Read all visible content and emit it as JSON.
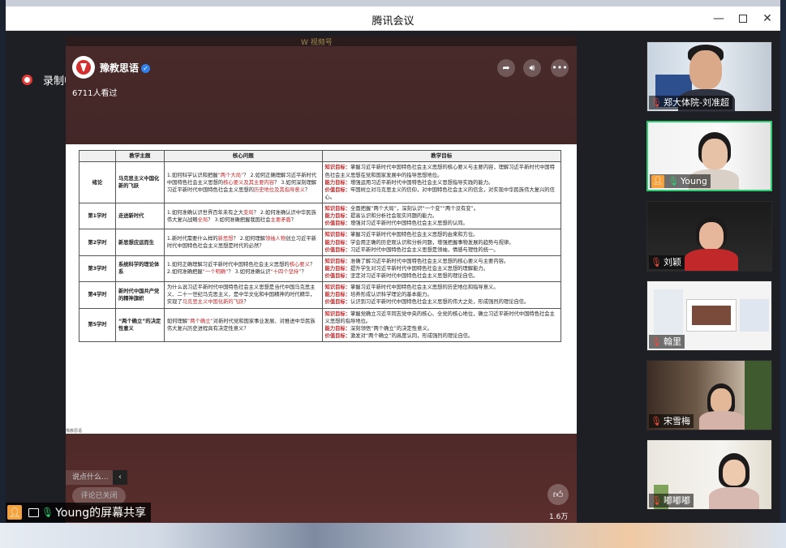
{
  "window": {
    "title": "腾讯会议"
  },
  "recording": {
    "label": "录制中"
  },
  "shared": {
    "top_logo": "W 视频号",
    "channel_name": "豫教思语",
    "viewed": "6711人看过",
    "comment_placeholder": "说点什么...",
    "comment_arrow": "‹",
    "comment_closed": "评论已关闭",
    "like_count": "1.6万",
    "slide_footer": "豫教思语"
  },
  "slide_table": {
    "headers": [
      "",
      "教学主题",
      "核心问题",
      "教学目标"
    ],
    "rows": [
      {
        "c1": "绪论",
        "c2": "马克思主义中国化新的飞跃",
        "c3a": "1.如何科学认识和把握",
        "c3a_red": "“两个大局”",
        "c3b": "？ 2.如何正确理解习近平新时代中国特色社会主义思想的",
        "c3b_red": "核心要义及其主要内容",
        "c3c": "？ 3.如何深刻理解习近平新时代中国特色社会主义思想的",
        "c3c_red": "历史地位及其指导意义",
        "c3d": "？",
        "g1": "知识目标：",
        "t1": "掌握习近平新时代中国特色社会主义思想的核心要义与主要内容，理解习近平新时代中国特色社会主义思想在党和国家发展中的指导思想地位。",
        "g2": "能力目标：",
        "t2": "增强运用习近平新时代中国特色社会主义思想指导实践的能力。",
        "g3": "价值目标：",
        "t3": "牢固树立对马克思主义的信仰，对中国特色社会主义的信念，对实现中华民族伟大复兴的信心。"
      },
      {
        "c1": "第1学时",
        "c2": "走进新时代",
        "c3a": "1.如何准确认识世界百年未有之大",
        "c3a_red": "变局",
        "c3b": "？ 2.如何准确认识中华民族伟大复兴战略",
        "c3b_red": "全局",
        "c3c": "？ 3.如何准确把握我国社会",
        "c3c_red": "主要矛盾",
        "c3d": "？",
        "g1": "知识目标：",
        "t1": "全面把握“两个大局”，深刻认识“一个变”“两个没有变”。",
        "g2": "能力目标：",
        "t2": "提高认识和分析社会现实问题的能力。",
        "g3": "价值目标：",
        "t3": "增强对习近平新时代中国特色社会主义思想的认同。"
      },
      {
        "c1": "第2学时",
        "c2": "新思想应运而生",
        "c3a": "1.新时代需要什么样的",
        "c3a_red": "新思想",
        "c3b": "？ 2.如何理解",
        "c3b_red": "领袖人物",
        "c3c": "创立习近平新时代中国特色社会主义思想是时代的必然？",
        "c3c_red": "",
        "c3d": "",
        "g1": "知识目标：",
        "t1": "掌握习近平新时代中国特色社会主义思想的由来和方位。",
        "g2": "能力目标：",
        "t2": "学会用正确的历史观认识和分析问题，增强把握事物发展的趋势与规律。",
        "g3": "价值目标：",
        "t3": "习近平新时代中国特色社会主义思想是领袖，情感与理性的统一。"
      },
      {
        "c1": "第3学时",
        "c2": "系统科学的理论体系",
        "c3a": "1.如何正确理解习近平新时代中国特色社会主义思想的",
        "c3a_red": "核心要义",
        "c3b": "？ 2.如何准确把握",
        "c3b_red": "“一个明确”",
        "c3c": "？ 3.如何准确认识",
        "c3c_red": "“十四个坚持”",
        "c3d": "？",
        "g1": "知识目标：",
        "t1": "准确了解习近平新时代中国特色社会主义思想的核心要义与主要内容。",
        "g2": "能力目标：",
        "t2": "提升学生对习近平新时代中国特色社会主义思想的理解能力。",
        "g3": "价值目标：",
        "t3": "坚定对习近平新时代中国特色社会主义思想的理论自信。"
      },
      {
        "c1": "第4学时",
        "c2": "新时代中国共产党的精神旗帜",
        "c3a": "为什么说习近平新时代中国特色社会主义思想是当代中国马克思主义、二十一世纪马克思主义，是中华文化和中国精神的时代精华，实现了",
        "c3a_red": "马克思主义中国化新的飞跃",
        "c3b": "？",
        "c3b_red": "",
        "c3c": "",
        "c3c_red": "",
        "c3d": "",
        "g1": "知识目标：",
        "t1": "掌握习近平新时代中国特色社会主义思想的历史地位和指导意义。",
        "g2": "能力目标：",
        "t2": "培养形成认识科学理论的基本能力。",
        "g3": "价值目标：",
        "t3": "认识到习近平新时代中国特色社会主义思想的伟大之处，形成强烈的理论自信。"
      },
      {
        "c1": "第5学时",
        "c2": "“两个确立”的决定性意义",
        "c3a": "如何理解",
        "c3a_red": "“两个确立”",
        "c3b": "对新时代党和国家事业发展、对推进中华民族伟大复兴历史进程具有决定性意义？",
        "c3b_red": "",
        "c3c": "",
        "c3c_red": "",
        "c3d": "",
        "g1": "知识目标：",
        "t1": "掌握党确立习近平同志党中央的核心、全党的核心地位，确立习近平新时代中国特色社会主义思想的指导地位。",
        "g2": "能力目标：",
        "t2": "深刻领悟“两个确立”的决定性意义。",
        "g3": "价值目标：",
        "t3": "激发对“两个确立”的高度认同，形成强烈的理论自信。"
      }
    ]
  },
  "presenter": {
    "label": "Young的屏幕共享"
  },
  "participants": [
    {
      "name": "郑大体院-刘准超",
      "mic": "off"
    },
    {
      "name": "Young",
      "mic": "on",
      "active": true
    },
    {
      "name": "刘颖",
      "mic": "off"
    },
    {
      "name": "翰里",
      "mic": "off"
    },
    {
      "name": "宋雪梅",
      "mic": "off"
    },
    {
      "name": "嘟嘟嘟",
      "mic": "off"
    }
  ],
  "icons": {
    "minimize": "minimize-icon",
    "maximize": "maximize-icon",
    "close": "close-icon",
    "share": "share-arrow-icon",
    "sound": "speaker-icon",
    "more": "more-icon",
    "like": "thumbs-up-icon",
    "mic_off": "mic-muted-icon",
    "mic_on": "mic-icon"
  },
  "colors": {
    "accent_green": "#2ecc71",
    "record_red": "#e53935",
    "slide_red": "#c0282a",
    "avatar_orange": "#f6a23a"
  }
}
